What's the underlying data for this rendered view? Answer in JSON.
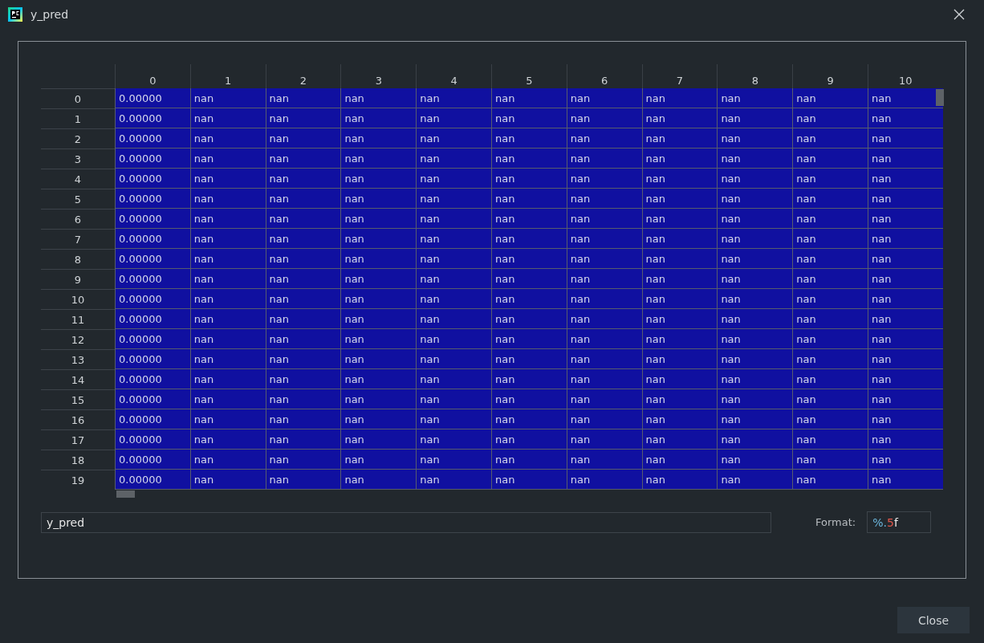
{
  "window": {
    "title": "y_pred"
  },
  "table": {
    "columns": [
      "0",
      "1",
      "2",
      "3",
      "4",
      "5",
      "6",
      "7",
      "8",
      "9",
      "10"
    ],
    "rows": [
      {
        "header": "0",
        "cells": [
          "0.00000",
          "nan",
          "nan",
          "nan",
          "nan",
          "nan",
          "nan",
          "nan",
          "nan",
          "nan",
          "nan"
        ]
      },
      {
        "header": "1",
        "cells": [
          "0.00000",
          "nan",
          "nan",
          "nan",
          "nan",
          "nan",
          "nan",
          "nan",
          "nan",
          "nan",
          "nan"
        ]
      },
      {
        "header": "2",
        "cells": [
          "0.00000",
          "nan",
          "nan",
          "nan",
          "nan",
          "nan",
          "nan",
          "nan",
          "nan",
          "nan",
          "nan"
        ]
      },
      {
        "header": "3",
        "cells": [
          "0.00000",
          "nan",
          "nan",
          "nan",
          "nan",
          "nan",
          "nan",
          "nan",
          "nan",
          "nan",
          "nan"
        ]
      },
      {
        "header": "4",
        "cells": [
          "0.00000",
          "nan",
          "nan",
          "nan",
          "nan",
          "nan",
          "nan",
          "nan",
          "nan",
          "nan",
          "nan"
        ]
      },
      {
        "header": "5",
        "cells": [
          "0.00000",
          "nan",
          "nan",
          "nan",
          "nan",
          "nan",
          "nan",
          "nan",
          "nan",
          "nan",
          "nan"
        ]
      },
      {
        "header": "6",
        "cells": [
          "0.00000",
          "nan",
          "nan",
          "nan",
          "nan",
          "nan",
          "nan",
          "nan",
          "nan",
          "nan",
          "nan"
        ]
      },
      {
        "header": "7",
        "cells": [
          "0.00000",
          "nan",
          "nan",
          "nan",
          "nan",
          "nan",
          "nan",
          "nan",
          "nan",
          "nan",
          "nan"
        ]
      },
      {
        "header": "8",
        "cells": [
          "0.00000",
          "nan",
          "nan",
          "nan",
          "nan",
          "nan",
          "nan",
          "nan",
          "nan",
          "nan",
          "nan"
        ]
      },
      {
        "header": "9",
        "cells": [
          "0.00000",
          "nan",
          "nan",
          "nan",
          "nan",
          "nan",
          "nan",
          "nan",
          "nan",
          "nan",
          "nan"
        ]
      },
      {
        "header": "10",
        "cells": [
          "0.00000",
          "nan",
          "nan",
          "nan",
          "nan",
          "nan",
          "nan",
          "nan",
          "nan",
          "nan",
          "nan"
        ]
      },
      {
        "header": "11",
        "cells": [
          "0.00000",
          "nan",
          "nan",
          "nan",
          "nan",
          "nan",
          "nan",
          "nan",
          "nan",
          "nan",
          "nan"
        ]
      },
      {
        "header": "12",
        "cells": [
          "0.00000",
          "nan",
          "nan",
          "nan",
          "nan",
          "nan",
          "nan",
          "nan",
          "nan",
          "nan",
          "nan"
        ]
      },
      {
        "header": "13",
        "cells": [
          "0.00000",
          "nan",
          "nan",
          "nan",
          "nan",
          "nan",
          "nan",
          "nan",
          "nan",
          "nan",
          "nan"
        ]
      },
      {
        "header": "14",
        "cells": [
          "0.00000",
          "nan",
          "nan",
          "nan",
          "nan",
          "nan",
          "nan",
          "nan",
          "nan",
          "nan",
          "nan"
        ]
      },
      {
        "header": "15",
        "cells": [
          "0.00000",
          "nan",
          "nan",
          "nan",
          "nan",
          "nan",
          "nan",
          "nan",
          "nan",
          "nan",
          "nan"
        ]
      },
      {
        "header": "16",
        "cells": [
          "0.00000",
          "nan",
          "nan",
          "nan",
          "nan",
          "nan",
          "nan",
          "nan",
          "nan",
          "nan",
          "nan"
        ]
      },
      {
        "header": "17",
        "cells": [
          "0.00000",
          "nan",
          "nan",
          "nan",
          "nan",
          "nan",
          "nan",
          "nan",
          "nan",
          "nan",
          "nan"
        ]
      },
      {
        "header": "18",
        "cells": [
          "0.00000",
          "nan",
          "nan",
          "nan",
          "nan",
          "nan",
          "nan",
          "nan",
          "nan",
          "nan",
          "nan"
        ]
      },
      {
        "header": "19",
        "cells": [
          "0.00000",
          "nan",
          "nan",
          "nan",
          "nan",
          "nan",
          "nan",
          "nan",
          "nan",
          "nan",
          "nan"
        ]
      }
    ]
  },
  "name_field": {
    "value": "y_pred"
  },
  "format": {
    "label": "Format:",
    "tokens": [
      {
        "text": "%.",
        "color": "#6cb6dc"
      },
      {
        "text": "5",
        "color": "#e0564a"
      },
      {
        "text": "f",
        "color": "#e8e8e8"
      }
    ]
  },
  "buttons": [
    "Close"
  ]
}
